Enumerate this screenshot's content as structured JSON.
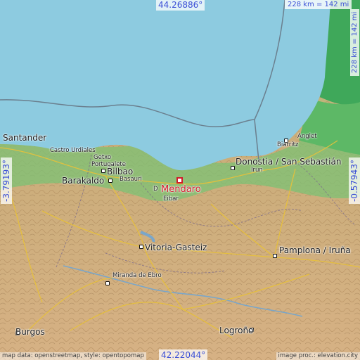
{
  "map": {
    "marker": {
      "name": "Mendaro"
    },
    "places": [
      {
        "id": "santander",
        "name": "Santander",
        "size": "big"
      },
      {
        "id": "castro-urdiales",
        "name": "Castro Urdiales",
        "size": "small"
      },
      {
        "id": "getxo",
        "name": "Getxo",
        "size": "small"
      },
      {
        "id": "portugalete",
        "name": "Portugalete",
        "size": "small"
      },
      {
        "id": "bilbao",
        "name": "Bilbao",
        "size": "big"
      },
      {
        "id": "barakaldo",
        "name": "Barakaldo",
        "size": "big"
      },
      {
        "id": "basauri",
        "name": "Basauri",
        "size": "small"
      },
      {
        "id": "durango",
        "name": "D",
        "size": "small"
      },
      {
        "id": "eibar",
        "name": "Eibar",
        "size": "small"
      },
      {
        "id": "donostia",
        "name": "Donostia / San Sebastián",
        "size": "big"
      },
      {
        "id": "irun",
        "name": "Irun",
        "size": "small"
      },
      {
        "id": "biarritz",
        "name": "Biarritz",
        "size": "small"
      },
      {
        "id": "anglet",
        "name": "Anglet",
        "size": "small"
      },
      {
        "id": "vitoria",
        "name": "Vitoria-Gasteiz",
        "size": "big"
      },
      {
        "id": "pamplona",
        "name": "Pamplona / Iruña",
        "size": "big"
      },
      {
        "id": "miranda",
        "name": "Miranda de Ebro",
        "size": "small"
      },
      {
        "id": "logrono",
        "name": "Logroño",
        "size": "big"
      },
      {
        "id": "burgos",
        "name": "Burgos",
        "size": "big"
      }
    ],
    "coordinates": {
      "top": "44.26886°",
      "bottom": "42.22044°",
      "left": "-3.79193°",
      "right": "-0.57943°"
    },
    "scale": {
      "top": "228 km = 142 mi",
      "right": "228 km = 142 mi"
    },
    "attribution": {
      "left": "map data: openstreetmap, style: opentopomap",
      "right": "image proc.: elevation.city"
    },
    "colors": {
      "sea": "#8dcbe0",
      "lowland": "#4fb56a",
      "relief": "#c9a77a",
      "highland": "#d6b58a",
      "marker": "#d11a2a",
      "coordinate_text": "#3b4fd6"
    }
  }
}
